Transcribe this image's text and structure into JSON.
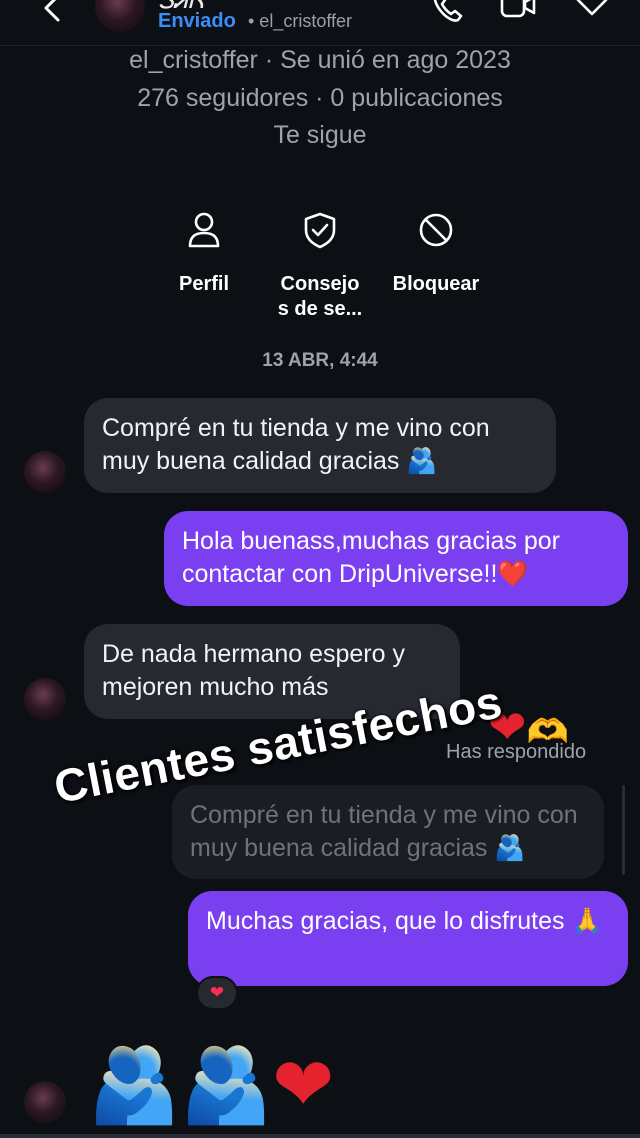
{
  "header": {
    "contact_name": "ᏕᏗᏒ",
    "status": "Enviado",
    "username": "• el_cristoffer"
  },
  "profile": {
    "line1": "el_cristoffer · Se unió en ago 2023",
    "line2": "276 seguidores · 0 publicaciones",
    "line3": "Te sigue"
  },
  "actions": [
    {
      "label": "Perfil"
    },
    {
      "label": "Consejo\ns de se..."
    },
    {
      "label": "Bloquear"
    }
  ],
  "timestamp": "13 ABR, 4:44",
  "messages": [
    {
      "text": "Compré en tu tienda y me vino con muy buena calidad gracias 🫂"
    },
    {
      "text": "Hola buenass,muchas gracias por contactar con DripUniverse!!❤️"
    },
    {
      "text": "De nada hermano espero y mejoren mucho más"
    },
    {
      "text": "Compré en tu tienda y me vino con muy buena calidad gracias 🫂"
    },
    {
      "text": "Muchas gracias, que lo disfrutes 🙏"
    }
  ],
  "reply_label": "Has respondido",
  "reaction": "❤",
  "big_emojis": {
    "hug1": "🫂",
    "hug2": "🫂",
    "heart": "❤"
  },
  "sticker": {
    "heart": "❤",
    "hand_heart": "🫶"
  },
  "overlay_caption": "Clientes satisfechos",
  "colors": {
    "background": "#0c0f14",
    "incoming_bubble": "#262930",
    "outgoing_bubble": "#7b3ff2",
    "accent_blue": "#3b8ef7"
  }
}
